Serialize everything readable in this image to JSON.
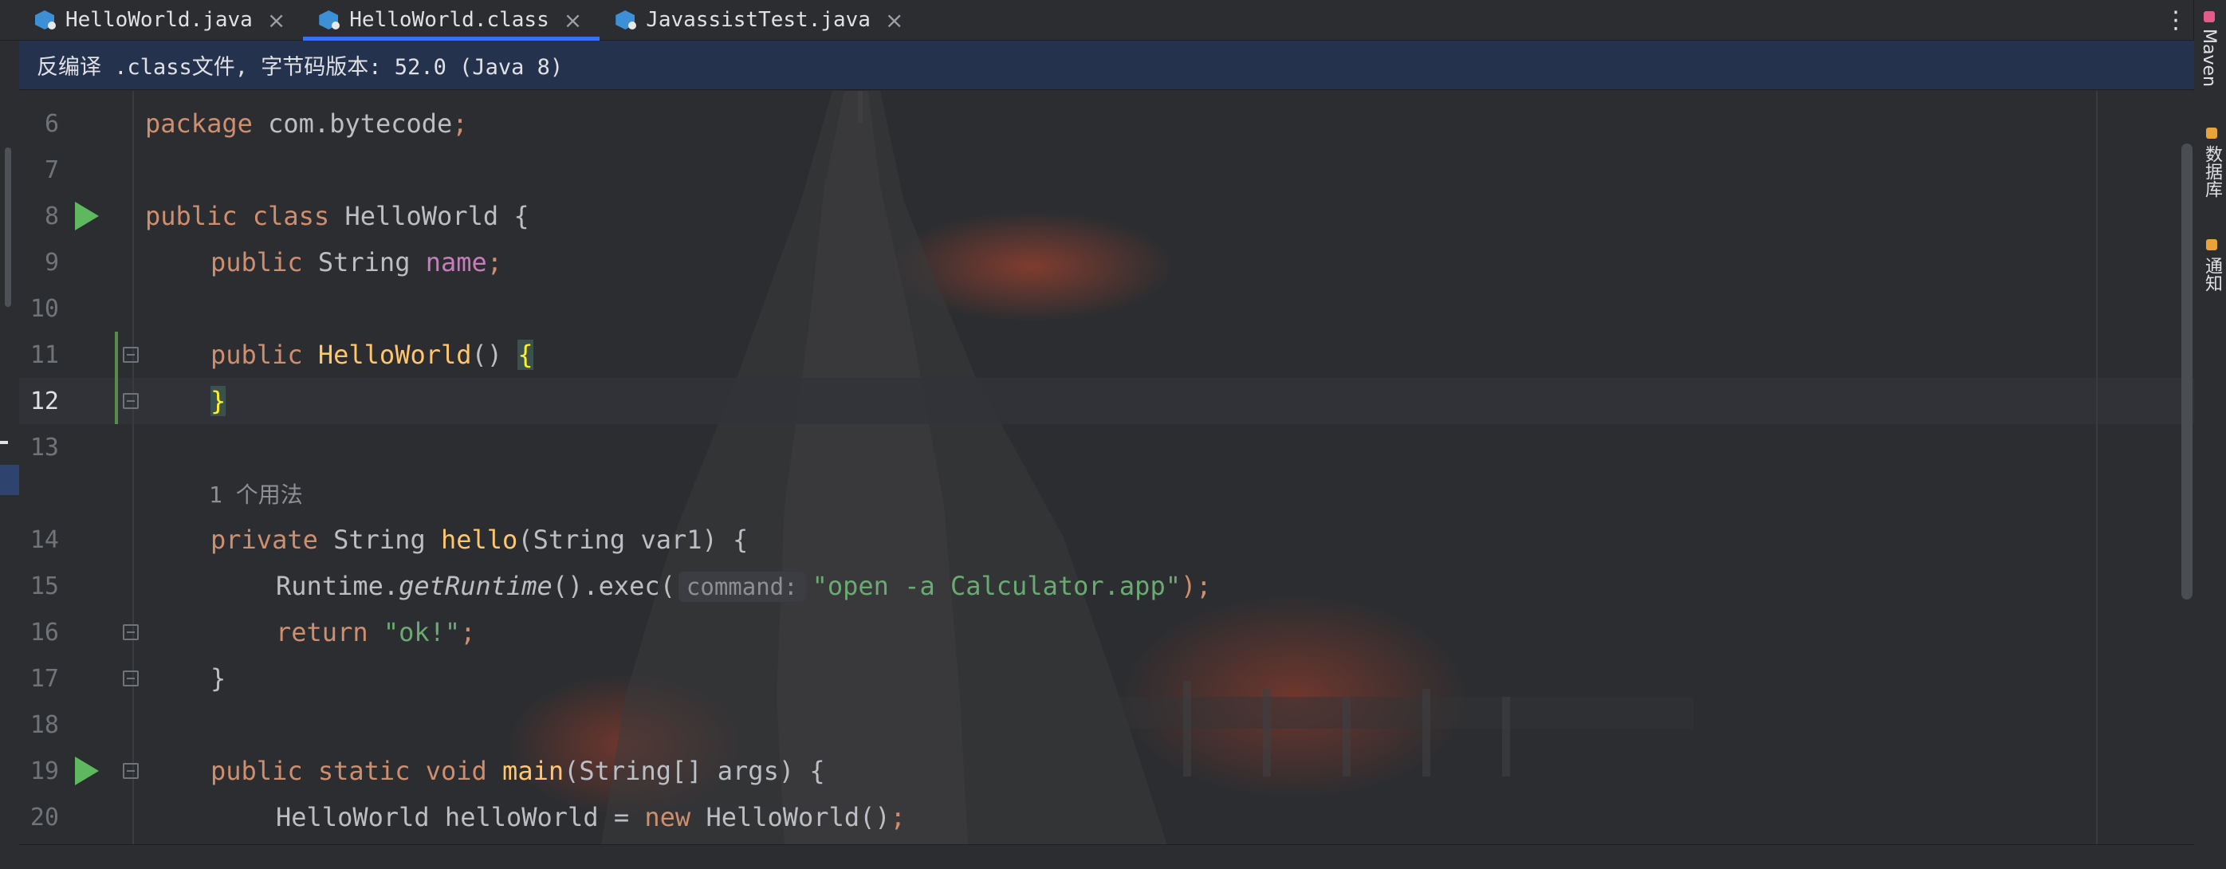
{
  "tabs": [
    {
      "label": "HelloWorld.java",
      "active": false
    },
    {
      "label": "HelloWorld.class",
      "active": true
    },
    {
      "label": "JavassistTest.java",
      "active": false
    }
  ],
  "tab_close_glyph": "×",
  "more_glyph": "⋮",
  "banner": {
    "text": "反编译 .class文件, 字节码版本: 52.0 (Java 8)"
  },
  "right_tools": [
    {
      "label": "Maven",
      "icon": "maven-icon",
      "color": "#e45a88"
    },
    {
      "label": "数据库",
      "icon": "database-icon",
      "color": "#e8a33a"
    },
    {
      "label": "通知",
      "icon": "bell-icon",
      "color": "#e8a33a"
    }
  ],
  "usage_hint": "1 个用法",
  "code_lines": [
    {
      "num": "6"
    },
    {
      "num": "7"
    },
    {
      "num": "8"
    },
    {
      "num": "9"
    },
    {
      "num": "10"
    },
    {
      "num": "11"
    },
    {
      "num": "12",
      "current": true
    },
    {
      "num": "13"
    },
    {
      "num": "14"
    },
    {
      "num": "15"
    },
    {
      "num": "16"
    },
    {
      "num": "17"
    },
    {
      "num": "18"
    },
    {
      "num": "19"
    },
    {
      "num": "20"
    }
  ],
  "tokens": {
    "l6": {
      "kw": "package",
      "rest": " com.bytecode",
      "semi": ";"
    },
    "l8": {
      "kw1": "public",
      "kw2": "class",
      "rest": " HelloWorld {"
    },
    "l9": {
      "kw": "public",
      "type": " String ",
      "field": "name",
      "semi": ";"
    },
    "l11": {
      "kw": "public",
      "fn": " HelloWorld",
      "parens": "() ",
      "brace": "{"
    },
    "l12": {
      "brace": "}"
    },
    "l14": {
      "kw": "private",
      "type": " String ",
      "fn": "hello",
      "rest": "(String var1) {"
    },
    "l15": {
      "cls": "Runtime.",
      "method": "getRuntime",
      "rest": "().exec(",
      "inlay": "command:",
      "str": "\"open -a Calculator.app\"",
      "end": ");"
    },
    "l16": {
      "kw": "return",
      "str": " \"ok!\"",
      "semi": ";"
    },
    "l17": {
      "rest": "}"
    },
    "l19": {
      "kw1": "public",
      "kw2": "static",
      "kw3": "void",
      "fn": "main",
      "rest": "(String[] args) {"
    },
    "l20": {
      "rest1": "HelloWorld helloWorld = ",
      "kw": "new",
      "rest2": " HelloWorld()",
      "semi": ";"
    }
  },
  "colors": {
    "keyword": "#cf8e6d",
    "function": "#ffc66d",
    "field": "#c77dbb",
    "string": "#6aab73",
    "tab_accent": "#3574f0",
    "banner_bg": "#25324d"
  }
}
